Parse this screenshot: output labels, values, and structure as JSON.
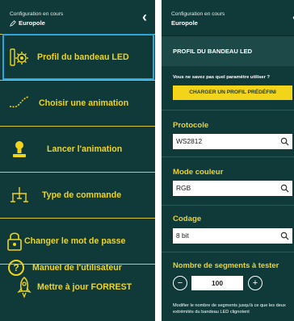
{
  "colors": {
    "background": "#0f3a39",
    "accent": "#f2d51a",
    "selection": "#2aa6d8",
    "divider": "#d9c43a"
  },
  "left": {
    "header": {
      "line1": "Configuration en cours",
      "project": "Europole",
      "back_icon": "chevron-left-icon"
    },
    "menu": [
      {
        "label": "Profil du bandeau LED",
        "icon": "led-profile-icon",
        "selected": true
      },
      {
        "label": "Choisir une animation",
        "icon": "animation-curve-icon"
      },
      {
        "label": "Lancer l'animation",
        "icon": "lamp-icon"
      },
      {
        "label": "Type de commande",
        "icon": "network-icon"
      },
      {
        "label": "Changer le mot de passe",
        "icon": "padlock-icon"
      },
      {
        "label": "Mettre à jour FORREST",
        "icon": "rocket-icon"
      },
      {
        "label": "Manuel de l'utilisateur",
        "icon": "help-icon"
      }
    ]
  },
  "right": {
    "header": {
      "line1": "Configuration en cours",
      "project": "Europole",
      "back_icon": "chevron-left-icon"
    },
    "title": "PROFIL DU BANDEAU LED",
    "question": "Vous ne savez pas quel paramètre utiliser ?",
    "load_button": "CHARGER UN PROFIL PRÉDÉFINI",
    "protocol": {
      "label": "Protocole",
      "value": "WS2812"
    },
    "color_mode": {
      "label": "Mode couleur",
      "value": "RGB"
    },
    "coding": {
      "label": "Codage",
      "value": "8 bit"
    },
    "segments": {
      "label": "Nombre de segments à tester",
      "minus": "−",
      "plus": "+",
      "value": "100"
    },
    "note": "Modifier le nombre de segments jusqu'à ce que les deux extrémités du bandeau LED clignotent"
  }
}
